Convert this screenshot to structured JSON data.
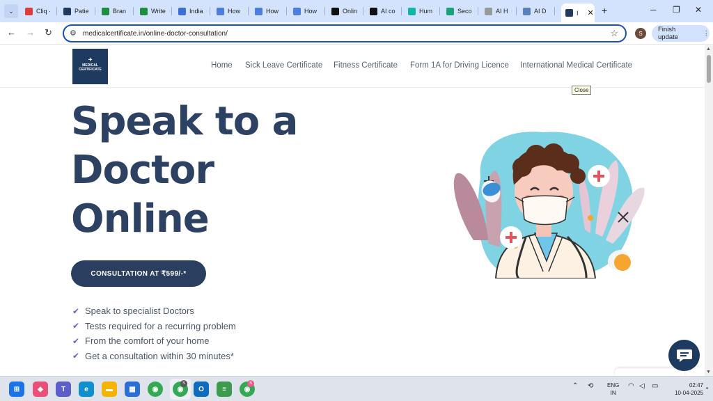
{
  "browser": {
    "tabs": [
      {
        "label": "Cliq ·",
        "color": "#e03b3b"
      },
      {
        "label": "Patie",
        "color": "#1e3a5f"
      },
      {
        "label": "Bran",
        "color": "#1e8e3e"
      },
      {
        "label": "Write",
        "color": "#1e8e3e"
      },
      {
        "label": "India",
        "color": "#3b6fd1"
      },
      {
        "label": "How",
        "color": "#4a7fe0"
      },
      {
        "label": "How",
        "color": "#4a7fe0"
      },
      {
        "label": "How",
        "color": "#4a7fe0"
      },
      {
        "label": "Onlin",
        "color": "#111111"
      },
      {
        "label": "AI co",
        "color": "#111111"
      },
      {
        "label": "Hum",
        "color": "#12b5a5"
      },
      {
        "label": "Seco",
        "color": "#1aa37a"
      },
      {
        "label": "AI H",
        "color": "#999999"
      },
      {
        "label": "AI D",
        "color": "#5a7fbf"
      }
    ],
    "active_tab": {
      "label": "I",
      "color": "#1e3a5f"
    },
    "url": "medicalcertificate.in/online-doctor-consultation/",
    "profile_initial": "S",
    "finish_update_label": "Finish update"
  },
  "header": {
    "logo_text": "MEDICAL CERTIFICATE",
    "nav": [
      "Home",
      "Sick Leave Certificate",
      "Fitness Certificate",
      "Form 1A for Driving Licence",
      "International Medical Certificate"
    ]
  },
  "tooltip": "Close",
  "hero": {
    "title_line1": "Speak to a",
    "title_line2": "Doctor",
    "title_line3": "Online",
    "cta_label": "CONSULTATION AT ₹599/-*",
    "benefits": [
      "Speak to specialist Doctors",
      "Tests required for a recurring problem",
      "From the comfort of your home",
      "Get a consultation within 30 minutes*"
    ]
  },
  "taskbar": {
    "lang_line1": "ENG",
    "lang_line2": "IN",
    "time": "02:47",
    "date": "10-04-2025"
  }
}
